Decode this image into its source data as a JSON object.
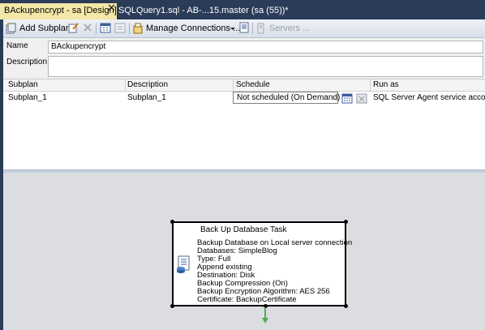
{
  "tabs": {
    "active_label": "BAckupencrypt - sa [Design]",
    "close_glyph": "✕",
    "inactive_label": "SQLQuery1.sql - AB-...15.master (sa (55))*"
  },
  "toolbar": {
    "add_subplan": "Add Subplan",
    "manage_connections": "Manage Connections ...",
    "servers": "Servers ..."
  },
  "props": {
    "name_label": "Name",
    "name_value": "BAckupencrypt",
    "description_label": "Description",
    "description_value": ""
  },
  "grid": {
    "columns": [
      "Subplan",
      "Description",
      "Schedule",
      "Run as"
    ],
    "rows": [
      {
        "subplan": "Subplan_1",
        "description": "Subplan_1",
        "schedule": "Not scheduled (On Demand)",
        "run_as": "SQL Server Agent service account"
      }
    ]
  },
  "task": {
    "title": "Back Up Database Task",
    "lines": [
      "Backup Database on Local server connection",
      "Databases: SimpleBlog",
      "Type: Full",
      "Append existing",
      "Destination: Disk",
      "Backup Compression (On)",
      "Backup Encryption Algorithm: AES 256",
      "Certificate: BackupCertificate"
    ]
  },
  "colors": {
    "tab_strip": "#2b3c59",
    "active_tab": "#f3e8a8",
    "connector_arrow": "#4caf50"
  }
}
